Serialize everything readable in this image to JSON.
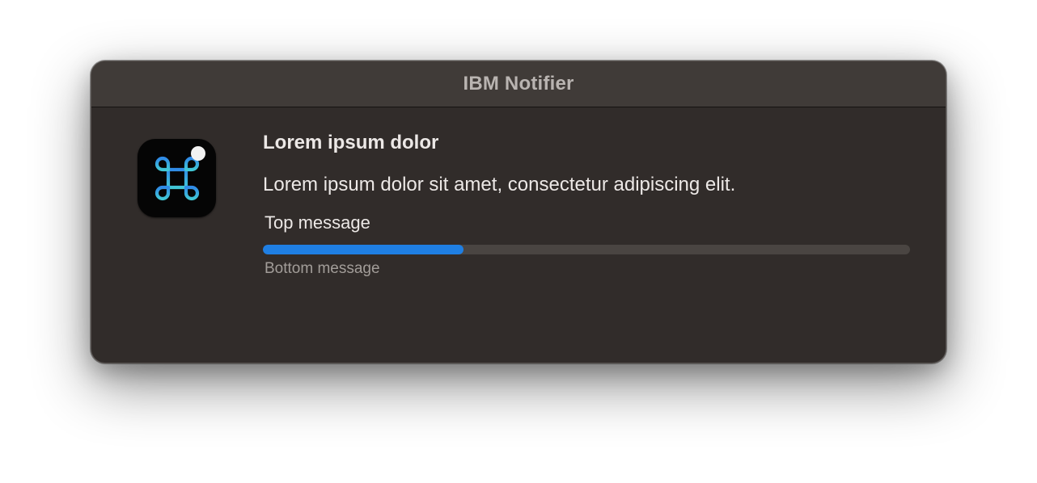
{
  "window": {
    "title": "IBM Notifier"
  },
  "app_icon": {
    "icon": "command-key-icon",
    "badge": "white-dot",
    "colors": {
      "background": "#050505",
      "glyph_gradient_top": "#2f8ae6",
      "glyph_gradient_bottom": "#41c7d6",
      "badge": "#f2f2f2"
    }
  },
  "notification": {
    "title": "Lorem ipsum dolor",
    "description": "Lorem ipsum dolor sit amet, consectetur adipiscing elit.",
    "top_message": "Top message",
    "bottom_message": "Bottom message",
    "progress": 0.31
  },
  "colors": {
    "window_background": "#312c2a",
    "titlebar_background": "#403b38",
    "progress_fill": "#1f7fe3",
    "progress_track": "#4a4542",
    "primary_text": "#ece8e6",
    "secondary_text": "#a29d99"
  }
}
